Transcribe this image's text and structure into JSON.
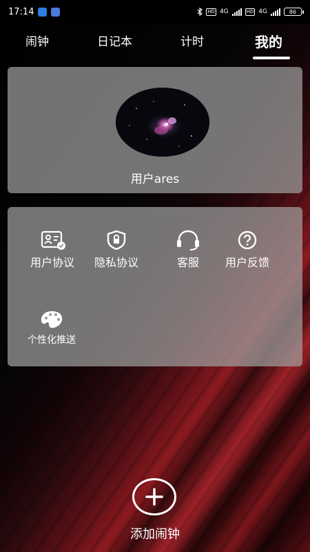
{
  "status_bar": {
    "time": "17:14",
    "network_1": "4G",
    "network_2": "4G",
    "hd_1": "HD",
    "hd_2": "HD",
    "battery": "86"
  },
  "tabs": [
    {
      "label": "闹钟",
      "active": false
    },
    {
      "label": "日记本",
      "active": false
    },
    {
      "label": "计时",
      "active": false
    },
    {
      "label": "我的",
      "active": true
    }
  ],
  "profile": {
    "username": "用户ares",
    "avatar_icon": "nebula-avatar-image"
  },
  "menu": {
    "items": [
      {
        "label": "用户协议",
        "icon": "id-card-check-icon"
      },
      {
        "label": "隐私协议",
        "icon": "shield-lock-icon"
      },
      {
        "label": "客服",
        "icon": "headset-icon"
      },
      {
        "label": "用户反馈",
        "icon": "question-circle-icon"
      },
      {
        "label": "个性化推送",
        "icon": "palette-icon"
      }
    ]
  },
  "add_alarm": {
    "label": "添加闹钟",
    "icon": "plus-icon"
  },
  "colors": {
    "card": "#a0a0a0",
    "accent_red": "#a3222a",
    "background": "#000000"
  }
}
